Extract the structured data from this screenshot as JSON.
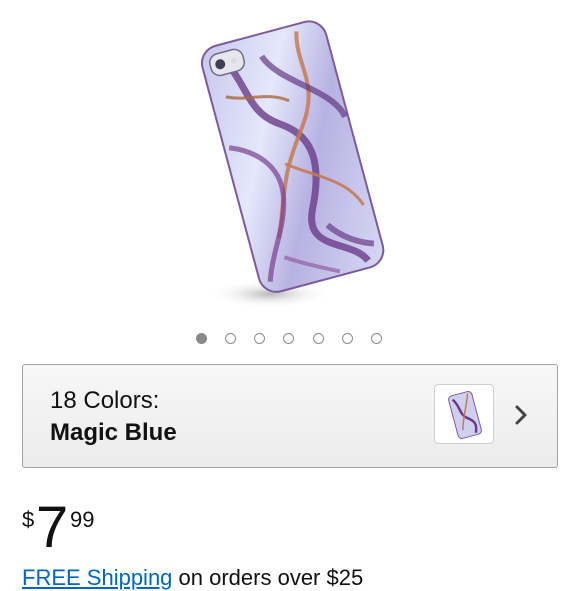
{
  "product": {
    "image_icon": "marble-phone-case-image",
    "carousel": {
      "count": 7,
      "active_index": 0
    }
  },
  "variant": {
    "count_label": "18 Colors:",
    "selected": "Magic Blue",
    "thumb_icon": "marble-phone-case-thumbnail",
    "chevron_icon": "chevron-right-icon"
  },
  "price": {
    "currency": "$",
    "whole": "7",
    "fraction": "99"
  },
  "shipping": {
    "link_text": "FREE Shipping",
    "rest_text": " on orders over $25"
  },
  "colors": {
    "link": "#0066c0",
    "marble_purple": "#6f3f8f",
    "marble_light": "#dfe3f7",
    "vein_copper": "#c57a55"
  }
}
